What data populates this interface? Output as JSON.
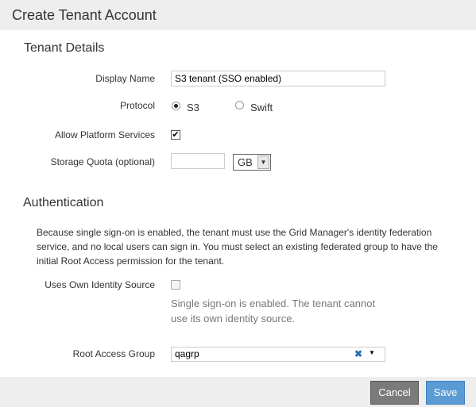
{
  "header": {
    "title": "Create Tenant Account"
  },
  "tenant_details": {
    "heading": "Tenant Details",
    "display_name": {
      "label": "Display Name",
      "value": "S3 tenant (SSO enabled)"
    },
    "protocol": {
      "label": "Protocol",
      "options": [
        "S3",
        "Swift"
      ],
      "selected": "S3"
    },
    "platform_services": {
      "label": "Allow Platform Services",
      "checked": true,
      "check_glyph": "✔"
    },
    "storage_quota": {
      "label": "Storage Quota (optional)",
      "value": "",
      "unit": "GB"
    }
  },
  "authentication": {
    "heading": "Authentication",
    "description": "Because single sign-on is enabled, the tenant must use the Grid Manager's identity federation service, and no local users can sign in. You must select an existing federated group to have the initial Root Access permission for the tenant.",
    "own_identity": {
      "label": "Uses Own Identity Source",
      "checked": false,
      "disabled": true,
      "help": "Single sign-on is enabled. The tenant cannot use its own identity source."
    },
    "root_access_group": {
      "label": "Root Access Group",
      "value": "qagrp",
      "clear_glyph": "✖",
      "clear_color": "#2a6fb5"
    }
  },
  "footer": {
    "cancel": "Cancel",
    "save": "Save",
    "cancel_color": "#7b7b7b",
    "save_color": "#5b9bd5"
  }
}
